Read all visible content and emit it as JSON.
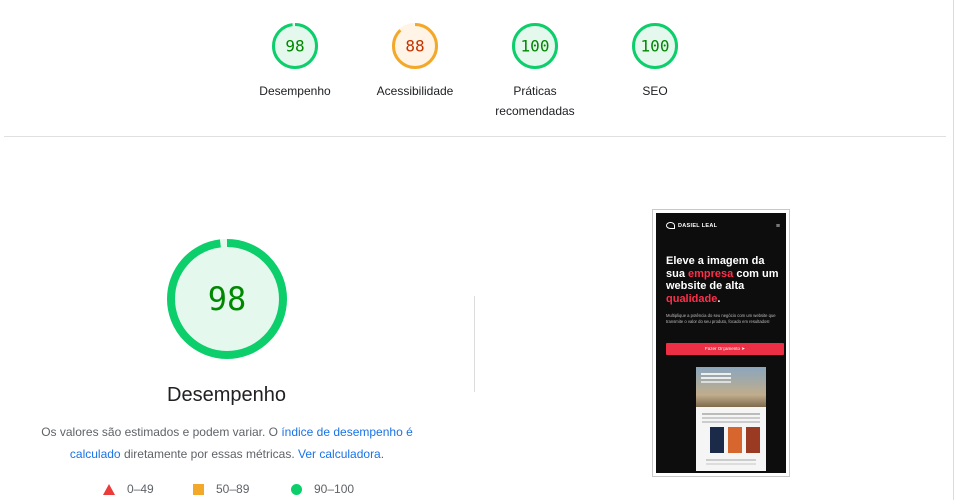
{
  "categories": [
    {
      "score": "98",
      "label": "Desempenho",
      "fraction": 0.98,
      "color": "#0cce6b",
      "text_color": "#008800",
      "bg": "#e5f8ee"
    },
    {
      "score": "88",
      "label": "Acessibilidade",
      "fraction": 0.88,
      "color": "#f4a82a",
      "text_color": "#c33300",
      "bg": "#fff4e6"
    },
    {
      "score": "100",
      "label": "Práticas recomendadas",
      "fraction": 1.0,
      "color": "#0cce6b",
      "text_color": "#008800",
      "bg": "#e5f8ee"
    },
    {
      "score": "100",
      "label": "SEO",
      "fraction": 1.0,
      "color": "#0cce6b",
      "text_color": "#008800",
      "bg": "#e5f8ee"
    }
  ],
  "performance": {
    "score": "98",
    "fraction": 0.98,
    "title": "Desempenho",
    "desc_prefix": "Os valores são estimados e podem variar. O ",
    "desc_link1": "índice de desempenho é calculado",
    "desc_middle": " diretamente por essas métricas. ",
    "desc_link2": "Ver calculadora",
    "desc_suffix": "."
  },
  "legend": [
    {
      "shape": "triangle",
      "range": "0–49",
      "color": "#eb3b3b"
    },
    {
      "shape": "square",
      "range": "50–89",
      "color": "#f4a82a"
    },
    {
      "shape": "circle",
      "range": "90–100",
      "color": "#0cce6b"
    }
  ],
  "screenshot": {
    "brand": "DASIEL LEAL",
    "headline_1": "Eleve a imagem da sua ",
    "headline_hl1": "empresa",
    "headline_2": " com um website de alta ",
    "headline_hl2": "qualidade",
    "headline_3": ".",
    "subtext": "Multiplique a potência do seu negócio com um website que transmite o valor do seu produto, focado em resultados!",
    "cta": "Fazer Orçamento"
  }
}
